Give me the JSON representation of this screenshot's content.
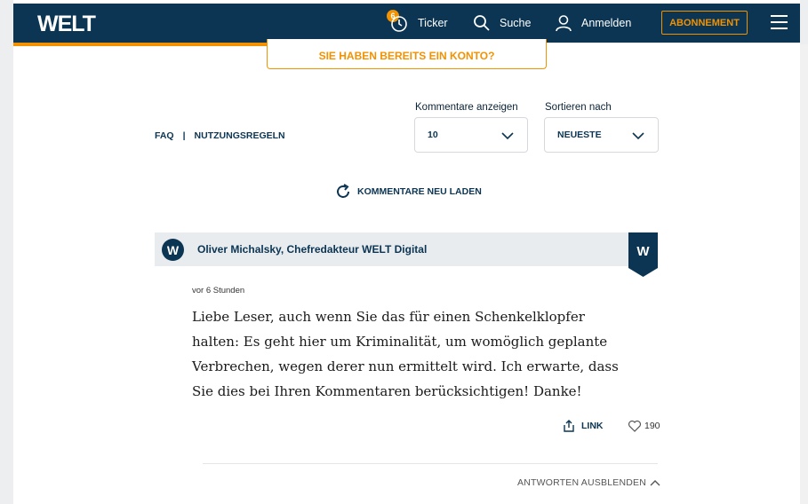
{
  "header": {
    "logo": "WELT",
    "ticker_badge": "6",
    "ticker_label": "Ticker",
    "search_label": "Suche",
    "login_label": "Anmelden",
    "subscription_label": "ABONNEMENT"
  },
  "login_prompt": "SIE HABEN BEREITS EIN KONTO?",
  "links": {
    "faq": "FAQ",
    "separator": "|",
    "rules": "NUTZUNGSREGELN"
  },
  "filters": {
    "show_label": "Kommentare anzeigen",
    "show_value": "10",
    "sort_label": "Sortieren nach",
    "sort_value": "NEUESTE"
  },
  "reload_label": "KOMMENTARE NEU LADEN",
  "comment": {
    "avatar_letter": "W",
    "author": "Oliver Michalsky, Chefredakteur WELT Digital",
    "badge_letter": "W",
    "time": "vor 6 Stunden",
    "text": "Liebe Leser, auch wenn Sie das für einen Schenkelklopfer halten: Es geht hier um Kriminalität, um womöglich geplante Verbrechen, wegen derer nun ermittelt wird. Ich erwarte, dass Sie dies bei Ihren Kommentaren berücksichtigen! Danke!",
    "link_label": "LINK",
    "likes": "190",
    "hide_replies": "ANTWORTEN AUSBLENDEN"
  },
  "colors": {
    "brand_navy": "#0b3553",
    "accent_orange": "#f39200"
  }
}
